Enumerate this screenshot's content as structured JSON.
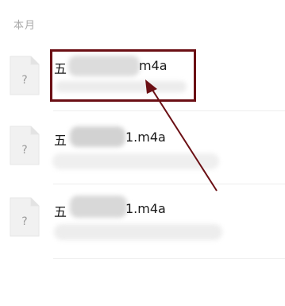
{
  "section": {
    "title": "本月"
  },
  "files": [
    {
      "name_prefix": "五",
      "name_suffix": "m4a",
      "icon": "unknown-file-icon",
      "icon_glyph": "?"
    },
    {
      "name_prefix": "五",
      "name_suffix": "1.m4a",
      "icon": "unknown-file-icon",
      "icon_glyph": "?"
    },
    {
      "name_prefix": "五",
      "name_suffix": "1.m4a",
      "icon": "unknown-file-icon",
      "icon_glyph": "?"
    }
  ],
  "colors": {
    "highlight": "#6b0f14",
    "header_text": "#a9a9a9",
    "blur": "#d9d9d9"
  }
}
